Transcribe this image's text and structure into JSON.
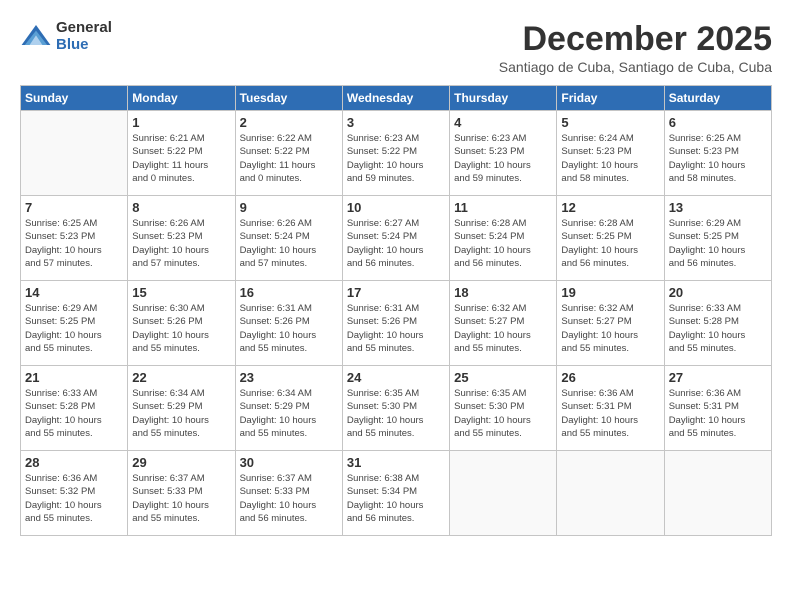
{
  "header": {
    "logo_general": "General",
    "logo_blue": "Blue",
    "month_title": "December 2025",
    "subtitle": "Santiago de Cuba, Santiago de Cuba, Cuba"
  },
  "weekdays": [
    "Sunday",
    "Monday",
    "Tuesday",
    "Wednesday",
    "Thursday",
    "Friday",
    "Saturday"
  ],
  "weeks": [
    [
      {
        "day": "",
        "info": ""
      },
      {
        "day": "1",
        "info": "Sunrise: 6:21 AM\nSunset: 5:22 PM\nDaylight: 11 hours\nand 0 minutes."
      },
      {
        "day": "2",
        "info": "Sunrise: 6:22 AM\nSunset: 5:22 PM\nDaylight: 11 hours\nand 0 minutes."
      },
      {
        "day": "3",
        "info": "Sunrise: 6:23 AM\nSunset: 5:22 PM\nDaylight: 10 hours\nand 59 minutes."
      },
      {
        "day": "4",
        "info": "Sunrise: 6:23 AM\nSunset: 5:23 PM\nDaylight: 10 hours\nand 59 minutes."
      },
      {
        "day": "5",
        "info": "Sunrise: 6:24 AM\nSunset: 5:23 PM\nDaylight: 10 hours\nand 58 minutes."
      },
      {
        "day": "6",
        "info": "Sunrise: 6:25 AM\nSunset: 5:23 PM\nDaylight: 10 hours\nand 58 minutes."
      }
    ],
    [
      {
        "day": "7",
        "info": "Sunrise: 6:25 AM\nSunset: 5:23 PM\nDaylight: 10 hours\nand 57 minutes."
      },
      {
        "day": "8",
        "info": "Sunrise: 6:26 AM\nSunset: 5:23 PM\nDaylight: 10 hours\nand 57 minutes."
      },
      {
        "day": "9",
        "info": "Sunrise: 6:26 AM\nSunset: 5:24 PM\nDaylight: 10 hours\nand 57 minutes."
      },
      {
        "day": "10",
        "info": "Sunrise: 6:27 AM\nSunset: 5:24 PM\nDaylight: 10 hours\nand 56 minutes."
      },
      {
        "day": "11",
        "info": "Sunrise: 6:28 AM\nSunset: 5:24 PM\nDaylight: 10 hours\nand 56 minutes."
      },
      {
        "day": "12",
        "info": "Sunrise: 6:28 AM\nSunset: 5:25 PM\nDaylight: 10 hours\nand 56 minutes."
      },
      {
        "day": "13",
        "info": "Sunrise: 6:29 AM\nSunset: 5:25 PM\nDaylight: 10 hours\nand 56 minutes."
      }
    ],
    [
      {
        "day": "14",
        "info": "Sunrise: 6:29 AM\nSunset: 5:25 PM\nDaylight: 10 hours\nand 55 minutes."
      },
      {
        "day": "15",
        "info": "Sunrise: 6:30 AM\nSunset: 5:26 PM\nDaylight: 10 hours\nand 55 minutes."
      },
      {
        "day": "16",
        "info": "Sunrise: 6:31 AM\nSunset: 5:26 PM\nDaylight: 10 hours\nand 55 minutes."
      },
      {
        "day": "17",
        "info": "Sunrise: 6:31 AM\nSunset: 5:26 PM\nDaylight: 10 hours\nand 55 minutes."
      },
      {
        "day": "18",
        "info": "Sunrise: 6:32 AM\nSunset: 5:27 PM\nDaylight: 10 hours\nand 55 minutes."
      },
      {
        "day": "19",
        "info": "Sunrise: 6:32 AM\nSunset: 5:27 PM\nDaylight: 10 hours\nand 55 minutes."
      },
      {
        "day": "20",
        "info": "Sunrise: 6:33 AM\nSunset: 5:28 PM\nDaylight: 10 hours\nand 55 minutes."
      }
    ],
    [
      {
        "day": "21",
        "info": "Sunrise: 6:33 AM\nSunset: 5:28 PM\nDaylight: 10 hours\nand 55 minutes."
      },
      {
        "day": "22",
        "info": "Sunrise: 6:34 AM\nSunset: 5:29 PM\nDaylight: 10 hours\nand 55 minutes."
      },
      {
        "day": "23",
        "info": "Sunrise: 6:34 AM\nSunset: 5:29 PM\nDaylight: 10 hours\nand 55 minutes."
      },
      {
        "day": "24",
        "info": "Sunrise: 6:35 AM\nSunset: 5:30 PM\nDaylight: 10 hours\nand 55 minutes."
      },
      {
        "day": "25",
        "info": "Sunrise: 6:35 AM\nSunset: 5:30 PM\nDaylight: 10 hours\nand 55 minutes."
      },
      {
        "day": "26",
        "info": "Sunrise: 6:36 AM\nSunset: 5:31 PM\nDaylight: 10 hours\nand 55 minutes."
      },
      {
        "day": "27",
        "info": "Sunrise: 6:36 AM\nSunset: 5:31 PM\nDaylight: 10 hours\nand 55 minutes."
      }
    ],
    [
      {
        "day": "28",
        "info": "Sunrise: 6:36 AM\nSunset: 5:32 PM\nDaylight: 10 hours\nand 55 minutes."
      },
      {
        "day": "29",
        "info": "Sunrise: 6:37 AM\nSunset: 5:33 PM\nDaylight: 10 hours\nand 55 minutes."
      },
      {
        "day": "30",
        "info": "Sunrise: 6:37 AM\nSunset: 5:33 PM\nDaylight: 10 hours\nand 56 minutes."
      },
      {
        "day": "31",
        "info": "Sunrise: 6:38 AM\nSunset: 5:34 PM\nDaylight: 10 hours\nand 56 minutes."
      },
      {
        "day": "",
        "info": ""
      },
      {
        "day": "",
        "info": ""
      },
      {
        "day": "",
        "info": ""
      }
    ]
  ]
}
